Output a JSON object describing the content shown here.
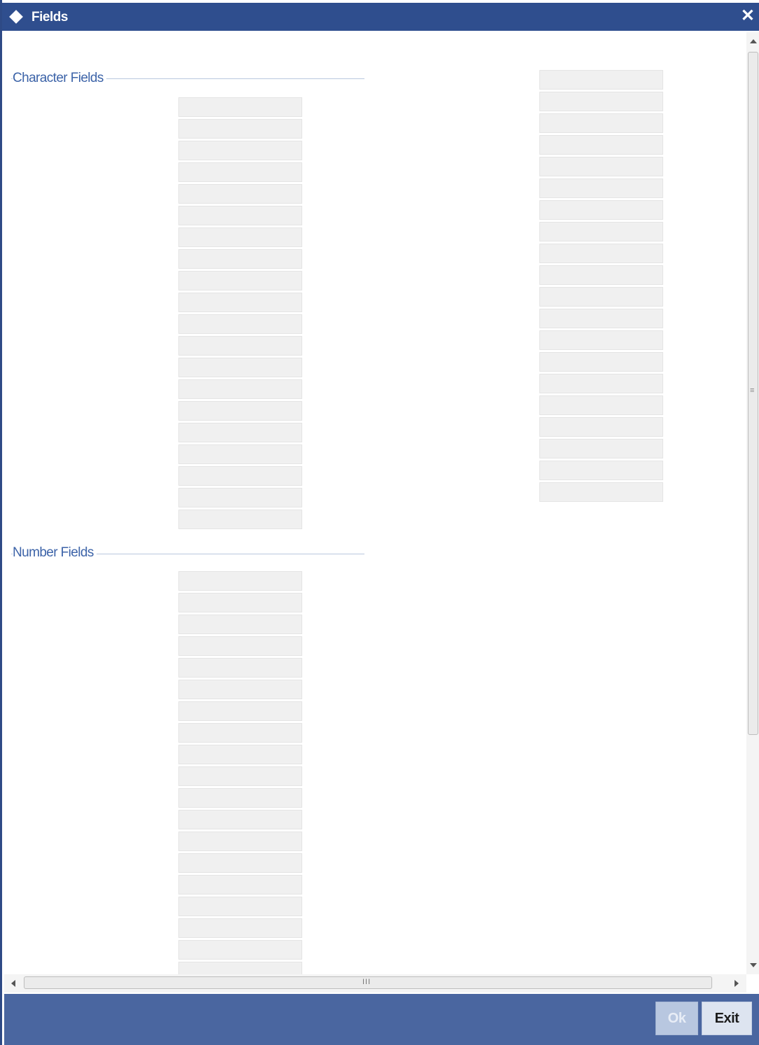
{
  "window": {
    "title": "Fields",
    "close_label": "✕"
  },
  "sections": {
    "character_fields_label": "Character Fields",
    "number_fields_label": "Number Fields"
  },
  "footer": {
    "ok_label": "Ok",
    "exit_label": "Exit"
  },
  "colors": {
    "titlebar": "#2f4e8e",
    "footer": "#4a66a0",
    "legend_text": "#3c63a8",
    "field_bg": "#f0f0f0"
  },
  "fields": {
    "character_left_count": 20,
    "character_right_count": 20,
    "number_visible_count": 19
  },
  "icons": [
    "diamond-icon",
    "close-icon",
    "scroll-up-arrow-icon",
    "scroll-down-arrow-icon",
    "scroll-left-arrow-icon",
    "scroll-right-arrow-icon"
  ]
}
